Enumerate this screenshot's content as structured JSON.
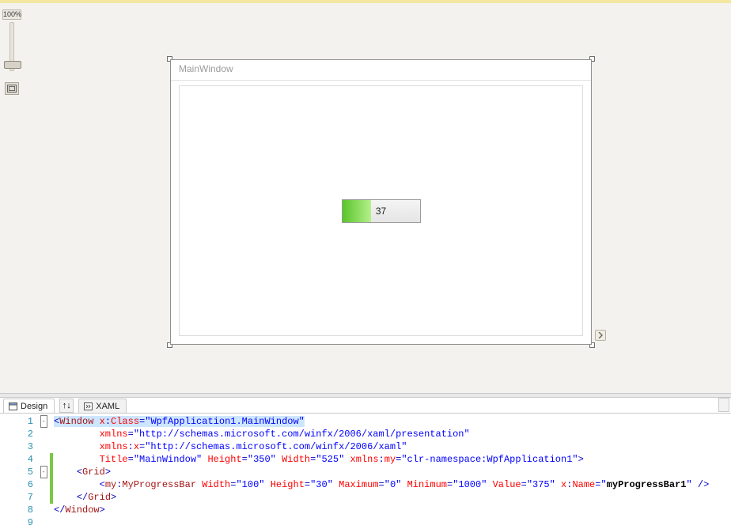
{
  "zoom": {
    "label": "100%"
  },
  "tabs": {
    "design": "Design",
    "swap_icon": "↑↓",
    "xaml": "XAML"
  },
  "window": {
    "title": "MainWindow",
    "progress_text": "37"
  },
  "code": {
    "lines": [
      {
        "n": 1,
        "fold": "-",
        "chg": false,
        "seg": [
          [
            "pun",
            "<"
          ],
          [
            "elem",
            "Window"
          ],
          [
            "",
            " "
          ],
          [
            "attr",
            "x"
          ],
          [
            "pun",
            ":"
          ],
          [
            "attr",
            "Class"
          ],
          [
            "pun",
            "="
          ],
          [
            "str",
            "\"WpfApplication1.MainWindow\""
          ]
        ],
        "hl": true
      },
      {
        "n": 2,
        "fold": "",
        "chg": false,
        "seg": [
          [
            "",
            "        "
          ],
          [
            "attr",
            "xmlns"
          ],
          [
            "pun",
            "="
          ],
          [
            "str",
            "\"http://schemas.microsoft.com/winfx/2006/xaml/presentation\""
          ]
        ]
      },
      {
        "n": 3,
        "fold": "",
        "chg": false,
        "seg": [
          [
            "",
            "        "
          ],
          [
            "attr",
            "xmlns"
          ],
          [
            "pun",
            ":"
          ],
          [
            "attr",
            "x"
          ],
          [
            "pun",
            "="
          ],
          [
            "str",
            "\"http://schemas.microsoft.com/winfx/2006/xaml\""
          ]
        ]
      },
      {
        "n": 4,
        "fold": "",
        "chg": true,
        "seg": [
          [
            "",
            "        "
          ],
          [
            "attr",
            "Title"
          ],
          [
            "pun",
            "="
          ],
          [
            "str",
            "\"MainWindow\""
          ],
          [
            "",
            " "
          ],
          [
            "attr",
            "Height"
          ],
          [
            "pun",
            "="
          ],
          [
            "str",
            "\"350\""
          ],
          [
            "",
            " "
          ],
          [
            "attr",
            "Width"
          ],
          [
            "pun",
            "="
          ],
          [
            "str",
            "\"525\""
          ],
          [
            "",
            " "
          ],
          [
            "attr",
            "xmlns"
          ],
          [
            "pun",
            ":"
          ],
          [
            "attr",
            "my"
          ],
          [
            "pun",
            "="
          ],
          [
            "str",
            "\"clr-namespace:WpfApplication1\""
          ],
          [
            "pun",
            ">"
          ]
        ]
      },
      {
        "n": 5,
        "fold": "-",
        "chg": true,
        "seg": [
          [
            "",
            "    "
          ],
          [
            "pun",
            "<"
          ],
          [
            "elem",
            "Grid"
          ],
          [
            "pun",
            ">"
          ]
        ]
      },
      {
        "n": 6,
        "fold": "",
        "chg": true,
        "seg": [
          [
            "",
            "        "
          ],
          [
            "pun",
            "<"
          ],
          [
            "elem",
            "my"
          ],
          [
            "pun",
            ":"
          ],
          [
            "elem",
            "MyProgressBar"
          ],
          [
            "",
            " "
          ],
          [
            "attr",
            "Width"
          ],
          [
            "pun",
            "="
          ],
          [
            "str",
            "\"100\""
          ],
          [
            "",
            " "
          ],
          [
            "attr",
            "Height"
          ],
          [
            "pun",
            "="
          ],
          [
            "str",
            "\"30\""
          ],
          [
            "",
            " "
          ],
          [
            "attr",
            "Maximum"
          ],
          [
            "pun",
            "="
          ],
          [
            "str",
            "\"0\""
          ],
          [
            "",
            " "
          ],
          [
            "attr",
            "Minimum"
          ],
          [
            "pun",
            "="
          ],
          [
            "str",
            "\"1000\""
          ],
          [
            "",
            " "
          ],
          [
            "attr",
            "Value"
          ],
          [
            "pun",
            "="
          ],
          [
            "str",
            "\"375\""
          ],
          [
            "",
            " "
          ],
          [
            "attr",
            "x"
          ],
          [
            "pun",
            ":"
          ],
          [
            "attr",
            "Name"
          ],
          [
            "pun",
            "="
          ],
          [
            "str",
            "\""
          ],
          [
            "bold",
            "myProgressBar1"
          ],
          [
            "str",
            "\""
          ],
          [
            "",
            " "
          ],
          [
            "pun",
            "/>"
          ]
        ]
      },
      {
        "n": 7,
        "fold": "",
        "chg": true,
        "seg": [
          [
            "",
            "    "
          ],
          [
            "pun",
            "</"
          ],
          [
            "elem",
            "Grid"
          ],
          [
            "pun",
            ">"
          ]
        ]
      },
      {
        "n": 8,
        "fold": "",
        "chg": false,
        "seg": [
          [
            "pun",
            "</"
          ],
          [
            "elem",
            "Window"
          ],
          [
            "pun",
            ">"
          ]
        ]
      },
      {
        "n": 9,
        "fold": "",
        "chg": false,
        "seg": []
      }
    ]
  }
}
